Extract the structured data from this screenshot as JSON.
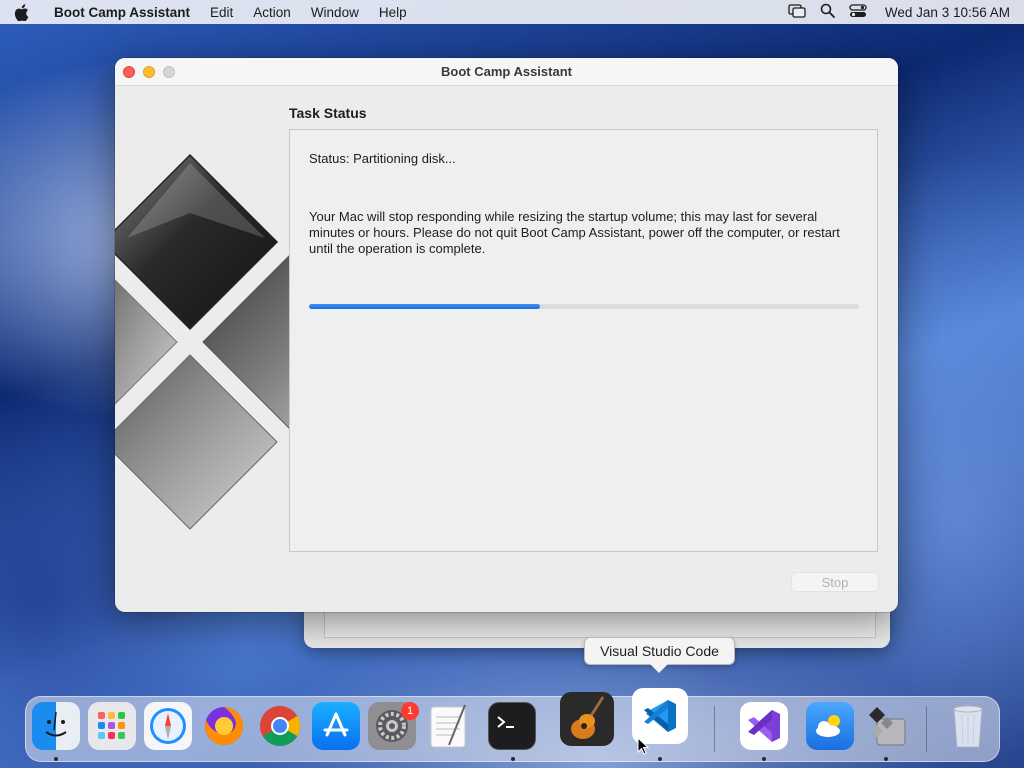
{
  "menubar": {
    "app_name": "Boot Camp Assistant",
    "items": [
      "Edit",
      "Action",
      "Window",
      "Help"
    ],
    "clock": "Wed Jan 3  10:56 AM"
  },
  "window": {
    "title": "Boot Camp Assistant",
    "section_title": "Task Status",
    "status": "Status: Partitioning disk...",
    "message": "Your Mac will stop responding while resizing the startup volume; this may last for several minutes or hours. Please do not quit Boot Camp Assistant, power off the computer, or restart until the operation is complete.",
    "progress": 0.42,
    "stop_label": "Stop"
  },
  "tooltip": "Visual Studio Code",
  "dock": {
    "apps": [
      "Finder",
      "Launchpad",
      "Safari",
      "Firefox",
      "Chrome",
      "App Store",
      "System Settings",
      "TextEdit",
      "Terminal",
      "GarageBand",
      "Visual Studio Code",
      "Visual Studio",
      "Weather",
      "Boot Camp Assistant",
      "Trash"
    ],
    "settings_badge": "1"
  }
}
